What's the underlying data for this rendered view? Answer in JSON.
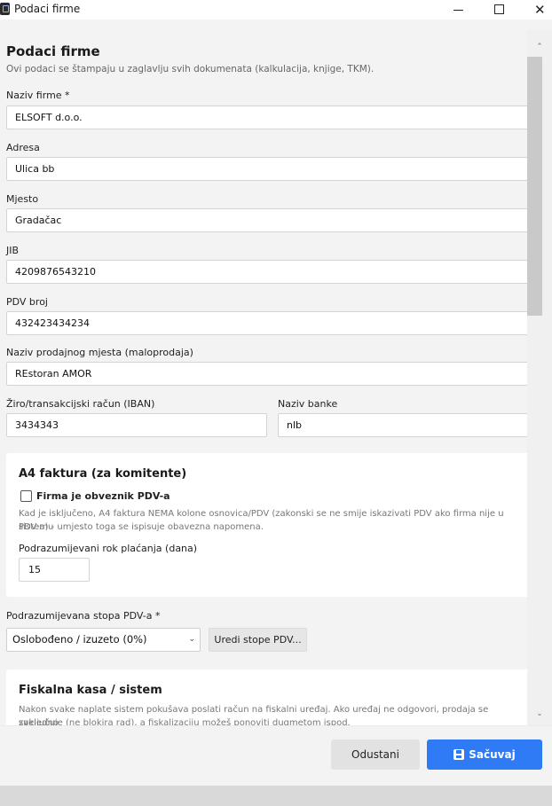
{
  "window": {
    "title": "Podaci firme"
  },
  "header": {
    "title": "Podaci firme",
    "subtitle": "Ovi podaci se štampaju u zaglavlju svih dokumenata (kalkulacija, knjige, TKM)."
  },
  "fields": {
    "naziv_label": "Naziv firme *",
    "naziv_value": "ELSOFT d.o.o.",
    "adresa_label": "Adresa",
    "adresa_value": "Ulica bb",
    "mjesto_label": "Mjesto",
    "mjesto_value": "Gradačac",
    "jib_label": "JIB",
    "jib_value": "4209876543210",
    "pdv_label": "PDV broj",
    "pdv_value": "432423434234",
    "prodajno_label": "Naziv prodajnog mjesta (maloprodaja)",
    "prodajno_value": "REstoran AMOR",
    "iban_label": "Žiro/transakcijski račun (IBAN)",
    "iban_value": "3434343",
    "banka_label": "Naziv banke",
    "banka_value": "nlb"
  },
  "a4": {
    "title": "A4 faktura (za komitente)",
    "checkbox_label": "Firma je obveznik PDV-a",
    "note_line1": "Kad je isključeno, A4 faktura NEMA kolone osnovica/PDV (zakonski se ne smije iskazivati PDV ako firma nije u sistemu",
    "note_line2": "PDV-a) - umjesto toga se ispisuje obavezna napomena.",
    "rok_label": "Podrazumijevani rok plaćanja (dana)",
    "rok_value": "15"
  },
  "pdv_stopa": {
    "label": "Podrazumijevana stopa PDV-a *",
    "selected": "Oslobođeno / izuzeto (0%)",
    "edit_button": "Uredi stope PDV..."
  },
  "fiskal": {
    "title": "Fiskalna kasa / sistem",
    "note_line1": "Nakon svake naplate sistem pokušava poslati račun na fiskalni uređaj. Ako uređaj ne odgovori, prodaja se svejedno",
    "note_line2": "zaključuje (ne blokira rad), a fiskalizaciju možeš ponoviti dugmetom ispod."
  },
  "footer": {
    "cancel": "Odustani",
    "save": "Sačuvaj"
  },
  "icons": {
    "window_close": "✕",
    "scroll_up": "⌃",
    "scroll_down": "⌄",
    "select_chevron": "⌄"
  }
}
